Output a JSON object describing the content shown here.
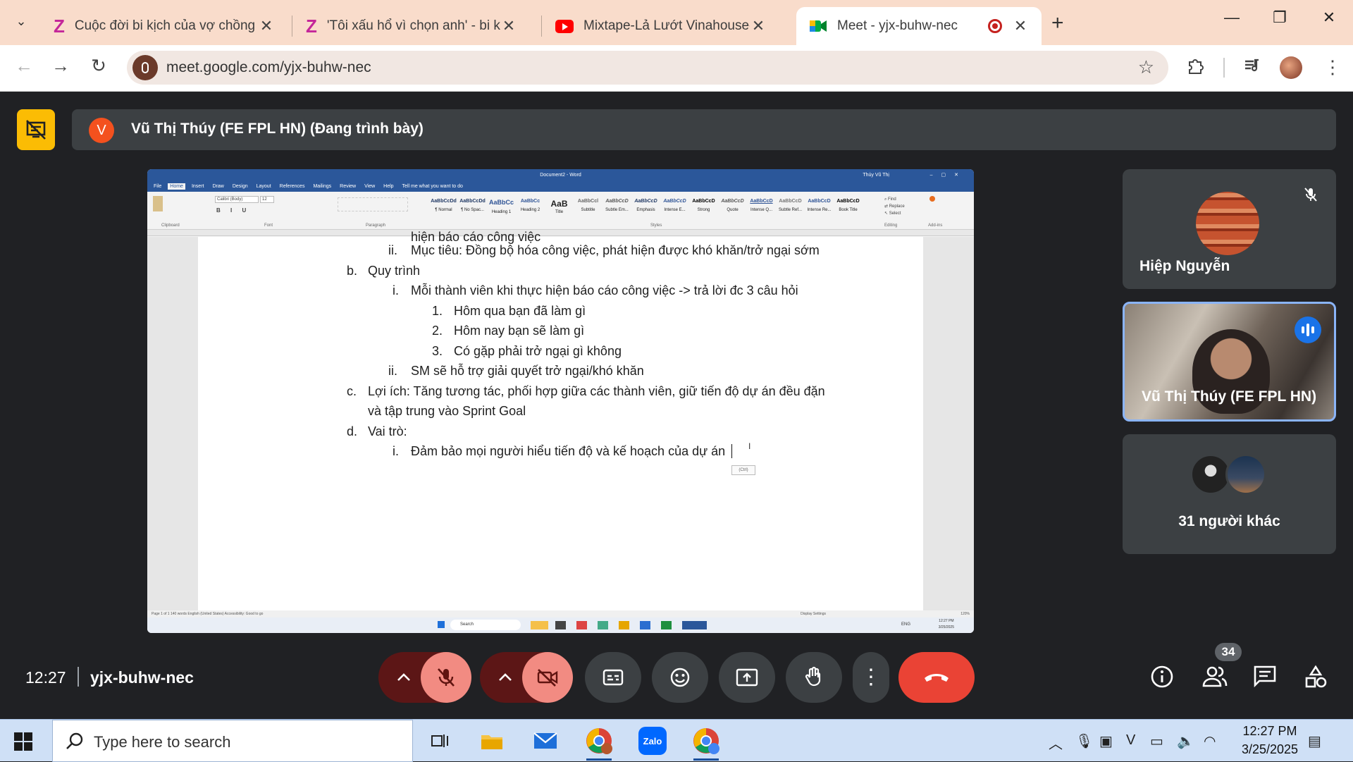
{
  "browser": {
    "tabs": [
      {
        "title": "Cuộc đời bi kịch của vợ chồng c",
        "icon": "zing-z-icon"
      },
      {
        "title": "'Tôi xấu hổ vì chọn anh' - bi kịch",
        "icon": "zing-z-icon"
      },
      {
        "title": "Mixtape-Lả Lướt Vinahouse-Bế",
        "icon": "youtube-icon"
      },
      {
        "title": "Meet - yjx-buhw-nec",
        "icon": "google-meet-icon"
      }
    ],
    "url": "meet.google.com/yjx-buhw-nec"
  },
  "meet": {
    "presenter_avatar_letter": "V",
    "presenter_label": "Vũ Thị Thúy (FE FPL HN) (Đang trình bày)",
    "meeting_time": "12:27",
    "meeting_code": "yjx-buhw-nec",
    "participant_count": "34",
    "tiles": [
      {
        "name": "Hiệp Nguyễn",
        "muted": true
      },
      {
        "name": "Vũ Thị Thúy (FE FPL HN)",
        "speaking": true
      },
      {
        "name": "31 người khác"
      }
    ]
  },
  "shared_doc": {
    "app_title": "Document2 - Word",
    "user": "Thúy Vũ Thị",
    "menu": [
      "File",
      "Home",
      "Insert",
      "Draw",
      "Design",
      "Layout",
      "References",
      "Mailings",
      "Review",
      "View",
      "Help",
      "Tell me what you want to do"
    ],
    "font_name": "Calibri (Body)",
    "font_size": "12",
    "groups": [
      "Clipboard",
      "Font",
      "Paragraph",
      "Styles",
      "Editing",
      "Add-ins"
    ],
    "styles": [
      {
        "sample": "AaBbCcDd",
        "name": "¶ Normal"
      },
      {
        "sample": "AaBbCcDd",
        "name": "¶ No Spac..."
      },
      {
        "sample": "AaBbCc",
        "name": "Heading 1"
      },
      {
        "sample": "AaBbCc",
        "name": "Heading 2"
      },
      {
        "sample": "AaB",
        "name": "Title"
      },
      {
        "sample": "AaBbCcl",
        "name": "Subtitle"
      },
      {
        "sample": "AaBbCcD",
        "name": "Subtle Em..."
      },
      {
        "sample": "AaBbCcD",
        "name": "Emphasis"
      },
      {
        "sample": "AaBbCcD",
        "name": "Intense E..."
      },
      {
        "sample": "AaBbCcD",
        "name": "Strong"
      },
      {
        "sample": "AaBbCcD",
        "name": "Quote"
      },
      {
        "sample": "AaBbCcD",
        "name": "Intense Q..."
      },
      {
        "sample": "AaBbCcD",
        "name": "Subtle Ref..."
      },
      {
        "sample": "AaBbCcD",
        "name": "Intense Re..."
      },
      {
        "sample": "AaBbCcD",
        "name": "Book Title"
      }
    ],
    "lines": [
      {
        "num": "",
        "text": "hiện báo cáo công việc"
      },
      {
        "num": "ii.",
        "text": "Mục tiêu: Đồng bộ hóa công việc, phát hiện được khó khăn/trở ngại sớm"
      },
      {
        "num": "b.",
        "text": "Quy trình"
      },
      {
        "num": "i.",
        "text": "Mỗi thành viên khi thực hiện báo cáo công việc -> trả lời đc 3 câu hỏi"
      },
      {
        "num": "1.",
        "text": "Hôm qua bạn đã làm gì"
      },
      {
        "num": "2.",
        "text": "Hôm nay bạn sẽ làm gì"
      },
      {
        "num": "3.",
        "text": "Có gặp phải trở ngại gì không"
      },
      {
        "num": "ii.",
        "text": "SM sẽ hỗ trợ giải quyết trở ngại/khó khăn"
      },
      {
        "num": "c.",
        "text": "Lợi ích: Tăng tương tác, phối hợp giữa các thành viên, giữ tiến độ dự án đều đặn"
      },
      {
        "num": "",
        "text": "và tập trung vào Sprint Goal"
      },
      {
        "num": "d.",
        "text": "Vai trò:"
      },
      {
        "num": "i.",
        "text": "Đảm bảo mọi người hiểu tiến độ và kế hoạch của dự án"
      }
    ],
    "paste_tag": "(Ctrl)",
    "status": "Page 1 of 1     140 words          English (United States)          Accessibility: Good to go",
    "status_right": "Display Settings",
    "zoom": "120%",
    "inner_search": "Search",
    "inner_time": "12:27 PM",
    "inner_date": "3/25/2025",
    "inner_lang": "ENG"
  },
  "taskbar": {
    "search_placeholder": "Type here to search",
    "time": "12:27 PM",
    "date": "3/25/2025"
  },
  "colors": {
    "tab_strip": "#f9dccb",
    "meet_bg": "#202124",
    "word_blue": "#2b579a",
    "end_call": "#ea4335",
    "present_yellow": "#fbbc04"
  }
}
